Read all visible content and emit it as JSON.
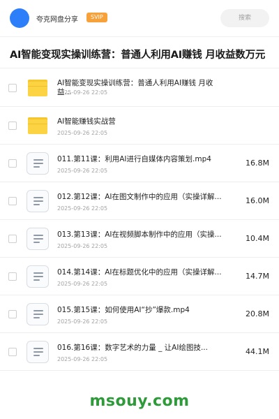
{
  "header": {
    "app_name": "夸克网盘分享",
    "badge": "SVIP",
    "search_placeholder": "搜索",
    "avatar_color": "#2d7ff9",
    "badge_color": "#f7a13a"
  },
  "title": "AI智能变现实操训练营：普通人利用AI赚钱 月收益数万元",
  "items": [
    {
      "type": "folder",
      "icon": "folder-icon",
      "name": "AI智能变现实操训练营：普通人利用AI赚钱 月收益...",
      "date": "2025-09-26 22:05",
      "size": ""
    },
    {
      "type": "folder",
      "icon": "folder-icon",
      "name": "AI智能赚钱实战营",
      "date": "2025-09-26 22:05",
      "size": ""
    },
    {
      "type": "file",
      "icon": "document-icon",
      "name": "011.第11课：利用AI进行自媒体内容策划.mp4",
      "date": "2025-09-26 22:05",
      "size": "16.8M"
    },
    {
      "type": "file",
      "icon": "document-icon",
      "name": "012.第12课：AI在图文制作中的应用（实操详解...",
      "date": "2025-09-26 22:05",
      "size": "16.0M"
    },
    {
      "type": "file",
      "icon": "document-icon",
      "name": "013.第13课：AI在视频脚本制作中的应用（实操...",
      "date": "2025-09-26 22:05",
      "size": "10.4M"
    },
    {
      "type": "file",
      "icon": "document-icon",
      "name": "014.第14课：AI在标题优化中的应用（实操详解...",
      "date": "2025-09-26 22:05",
      "size": "14.7M"
    },
    {
      "type": "file",
      "icon": "document-icon",
      "name": "015.第15课：如何使用AI“抄”爆款.mp4",
      "date": "2025-09-26 22:05",
      "size": "20.8M"
    },
    {
      "type": "file",
      "icon": "document-icon",
      "name": "016.第16课：数字艺术的力量 _ 让AI绘图技...",
      "date": "2025-09-26 22:05",
      "size": "44.1M"
    }
  ],
  "watermark": "msouy.com",
  "watermark_color": "#2e9a3a"
}
